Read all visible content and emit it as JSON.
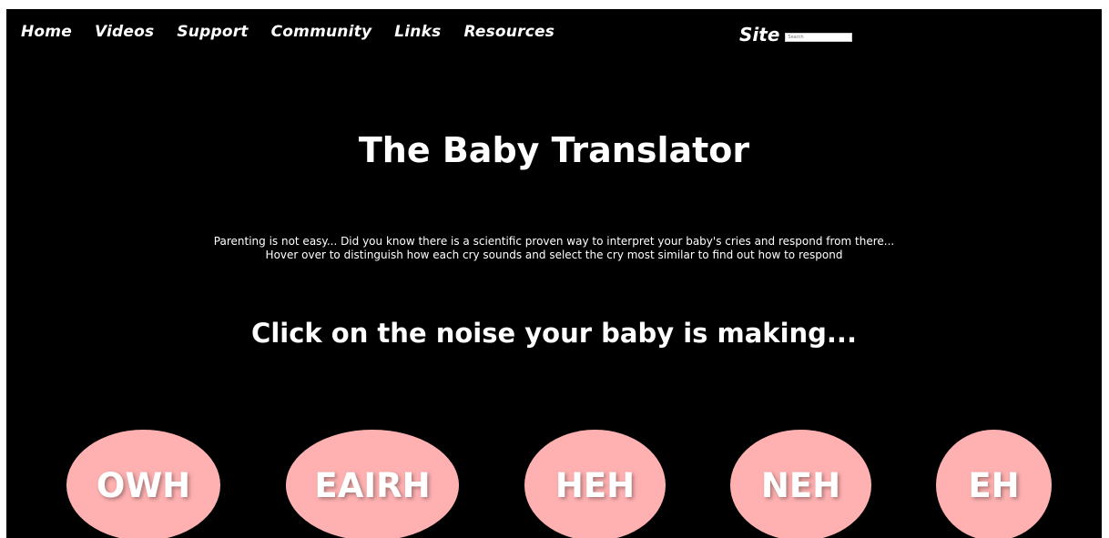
{
  "nav": {
    "items": [
      {
        "label": "Home"
      },
      {
        "label": "Videos"
      },
      {
        "label": "Support"
      },
      {
        "label": "Community"
      },
      {
        "label": "Links"
      },
      {
        "label": "Resources"
      }
    ]
  },
  "search": {
    "label": "Site",
    "placeholder": "Search"
  },
  "main": {
    "title": "The Baby Translator",
    "intro_line1": "Parenting is not easy... Did you know there is a scientific proven way to interpret your baby's cries and respond from there...",
    "intro_line2": "Hover over to distinguish how each cry sounds and select the cry most similar to find out how to respond",
    "prompt": "Click on the noise your baby is making..."
  },
  "cries": [
    {
      "label": "OWH"
    },
    {
      "label": "EAIRH"
    },
    {
      "label": "HEH"
    },
    {
      "label": "NEH"
    },
    {
      "label": "EH"
    }
  ],
  "colors": {
    "background": "#000000",
    "text": "#ffffff",
    "cry_button": "#ffb1b1"
  }
}
